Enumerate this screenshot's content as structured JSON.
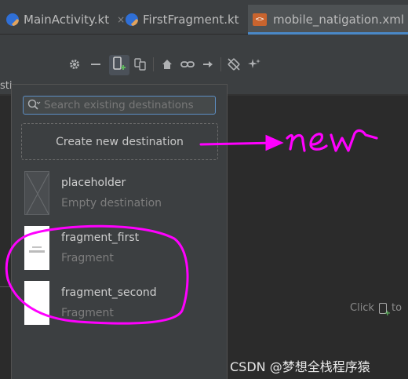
{
  "tabs": [
    {
      "label": "MainActivity.kt",
      "icon": "kotlin-file-icon",
      "active": false
    },
    {
      "label": "FirstFragment.kt",
      "icon": "kotlin-file-icon",
      "active": false
    },
    {
      "label": "mobile_natigation.xml",
      "icon": "xml-file-icon",
      "active": true
    }
  ],
  "tab_close_glyph": "×",
  "left_panel_fragment": "sti",
  "toolbar_icons": [
    "gear-icon",
    "minimize-icon",
    "new-destination-icon",
    "nested-graph-icon",
    "home-icon",
    "link-icon",
    "arrow-right-icon",
    "auto-connect-icon",
    "magic-icon"
  ],
  "popup": {
    "search_placeholder": "Search existing destinations",
    "create_label": "Create new destination",
    "destinations": [
      {
        "name": "placeholder",
        "type": "Empty destination"
      },
      {
        "name": "fragment_first",
        "type": "Fragment"
      },
      {
        "name": "fragment_second",
        "type": "Fragment"
      }
    ]
  },
  "canvas_hint": {
    "prefix": "Click",
    "suffix": "to"
  },
  "annotation": {
    "handwritten_text": "new",
    "color": "#ff00ff"
  },
  "watermark": "CSDN @梦想全栈程序猿",
  "colors": {
    "accent": "#4a88c7",
    "search_border": "#5d8ec4",
    "annotation": "#ff00ff"
  }
}
